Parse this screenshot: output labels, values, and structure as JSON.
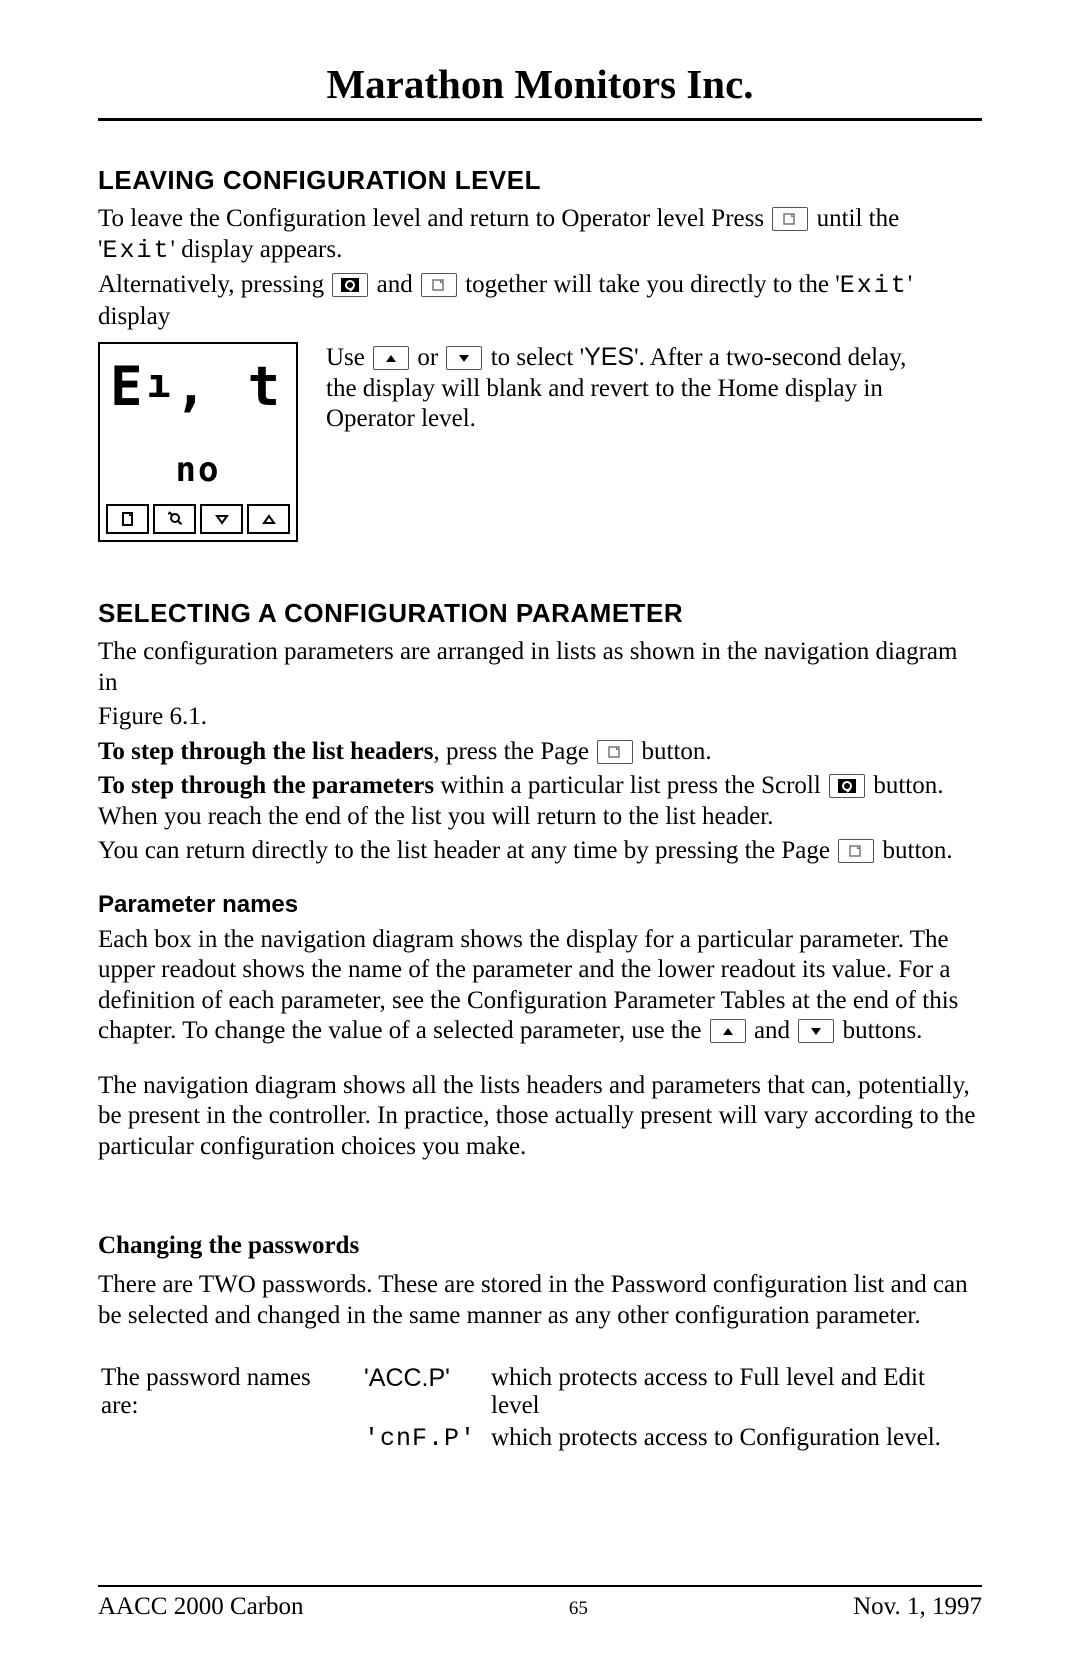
{
  "header": {
    "company": "Marathon Monitors Inc."
  },
  "s1": {
    "title": "LEAVING CONFIGURATION LEVEL",
    "p1a": "To leave the Configuration level and return to Operator level Press ",
    "p1b": " until the '",
    "exit": "Exit",
    "p1c": "' display appears.",
    "p2a": "Alternatively, pressing ",
    "p2b": " and ",
    "p2c": " together will take you directly to the '",
    "p2d": "' display",
    "dev_big": "Eₙ₁  t",
    "dev_big_raw": "Eₓ, t",
    "dev_small": "no",
    "p3a": "Use ",
    "p3b": " or ",
    "p3c": " to select '",
    "yes": "YES",
    "p3d": "'.  After a two-second delay, the display will blank and revert to the Home display in Operator level."
  },
  "s2": {
    "title": "SELECTING A CONFIGURATION PARAMETER",
    "p1": "The configuration parameters are arranged in lists as shown in the navigation diagram in",
    "fig": "Figure 6.1.",
    "p2a": "To step through the list headers",
    "p2b": ", press the Page ",
    "p2c": " button.",
    "p3a": "To step through the parameters",
    "p3b": " within a particular list press the Scroll ",
    "p3c": " button. When you reach the end of the list you will return to the list header.",
    "p4a": "You can return directly to the list header at any time by pressing the Page ",
    "p4b": " button."
  },
  "s3": {
    "title": "Parameter names",
    "p1a": "Each box in the navigation diagram shows the display for a particular parameter.  The upper readout shows the name of the parameter and the lower readout its value.  For a definition of each parameter, see the Configuration Parameter Tables at the end of this chapter.  To change the value of a selected parameter, use the ",
    "p1b": " and ",
    "p1c": " buttons.",
    "p2": "The navigation diagram shows all the lists headers and parameters that can, potentially, be present in the controller.   In practice, those actually present will vary according to the particular configuration choices you make."
  },
  "s4": {
    "title": "Changing the passwords",
    "p1": "There are TWO passwords.  These are stored in the Password configuration list and can be selected and changed in the same manner as any other configuration parameter.",
    "intro": "The password names are:",
    "r1a": "'ACC.P'",
    "r1b": "which protects access to Full level and Edit level",
    "r2a": "'cnF.P'",
    "r2b": "which protects access to Configuration level."
  },
  "footer": {
    "left": "AACC 2000 Carbon",
    "page": "65",
    "right": "Nov.  1, 1997"
  }
}
